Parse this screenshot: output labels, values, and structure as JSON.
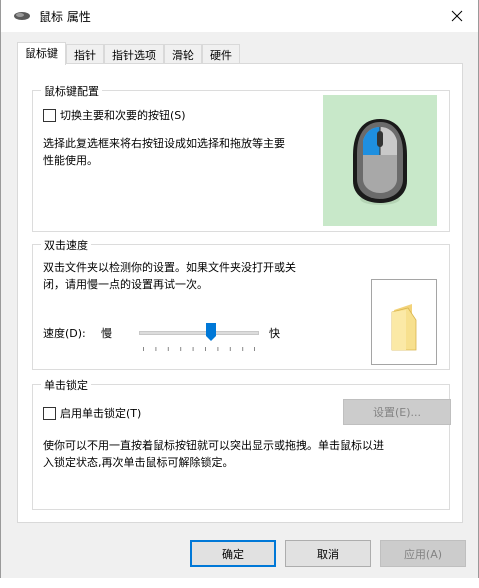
{
  "window": {
    "title": "鼠标 属性",
    "icon": "mouse-icon",
    "close_icon": "close-icon"
  },
  "tabs": [
    {
      "label": "鼠标键",
      "active": true
    },
    {
      "label": "指针",
      "active": false
    },
    {
      "label": "指针选项",
      "active": false
    },
    {
      "label": "滑轮",
      "active": false
    },
    {
      "label": "硬件",
      "active": false
    }
  ],
  "button_config": {
    "group_title": "鼠标键配置",
    "switch_label": "切换主要和次要的按钮(S)",
    "switch_checked": false,
    "description_line1": "选择此复选框来将右按钮设成如选择和拖放等主要",
    "description_line2": "性能使用。"
  },
  "double_click": {
    "group_title": "双击速度",
    "description_line1": "双击文件夹以检测你的设置。如果文件夹没打开或关",
    "description_line2": "闭，请用慢一点的设置再试一次。",
    "speed_label": "速度(D):",
    "slow_label": "慢",
    "fast_label": "快",
    "speed_fraction": 0.6
  },
  "click_lock": {
    "group_title": "单击锁定",
    "enable_label": "启用单击锁定(T)",
    "enable_checked": false,
    "settings_button": "设置(E)...",
    "description_line1": "使你可以不用一直按着鼠标按钮就可以突出显示或拖拽。单击鼠标以进",
    "description_line2": "入锁定状态,再次单击鼠标可解除锁定。"
  },
  "footer": {
    "ok": "确定",
    "cancel": "取消",
    "apply": "应用(A)"
  },
  "colors": {
    "accent": "#0078d7",
    "mouse_bg": "#c8e8c9"
  }
}
